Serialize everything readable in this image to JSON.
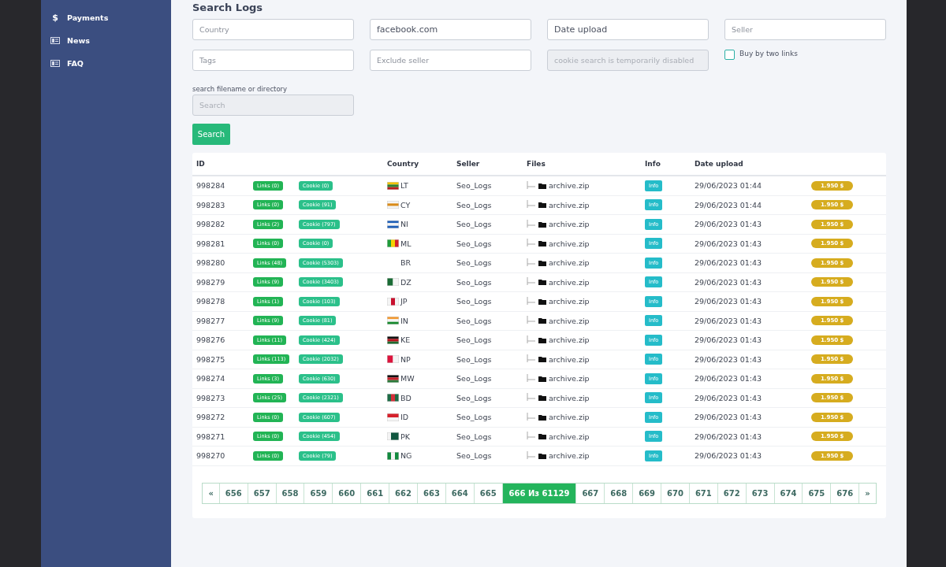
{
  "sidebar": {
    "items": [
      {
        "kind": "glyph",
        "glyph": "$",
        "label": "Payments"
      },
      {
        "kind": "card",
        "label": "News"
      },
      {
        "kind": "card",
        "label": "FAQ"
      }
    ]
  },
  "search_form": {
    "title": "Search Logs",
    "fields": [
      {
        "kind": "input",
        "placeholder": "Country"
      },
      {
        "kind": "input",
        "value": "facebook.com"
      },
      {
        "kind": "input",
        "value": "Date upload"
      },
      {
        "kind": "input",
        "placeholder": "Seller"
      },
      {
        "kind": "input",
        "placeholder": "Tags"
      },
      {
        "kind": "input",
        "placeholder": "Exclude seller"
      },
      {
        "kind": "input",
        "placeholder": "cookie search is temporarily disabled",
        "disabled": true
      },
      {
        "kind": "checkbox",
        "label": "Buy by two links",
        "checked": false
      }
    ],
    "filename_label": "search filename or directory",
    "filename_field": {
      "placeholder": "Search",
      "disabled": true
    },
    "button": "Search"
  },
  "table": {
    "columns": [
      "ID",
      "Country",
      "Seller",
      "Files",
      "Info",
      "Date upload"
    ],
    "rows": [
      {
        "id": "998284",
        "links": "Links (0)",
        "cookie": "Cookie (0)",
        "country": "LT",
        "seller": "Seo_Logs",
        "file": "archive.zip",
        "info": "Info",
        "date": "29/06/2023 01:44",
        "price": "1.950 $"
      },
      {
        "id": "998283",
        "links": "Links (0)",
        "cookie": "Cookie (91)",
        "country": "CY",
        "seller": "Seo_Logs",
        "file": "archive.zip",
        "info": "Info",
        "date": "29/06/2023 01:44",
        "price": "1.950 $"
      },
      {
        "id": "998282",
        "links": "Links (2)",
        "cookie": "Cookie (797)",
        "country": "NI",
        "seller": "Seo_Logs",
        "file": "archive.zip",
        "info": "Info",
        "date": "29/06/2023 01:43",
        "price": "1.950 $"
      },
      {
        "id": "998281",
        "links": "Links (0)",
        "cookie": "Cookie (0)",
        "country": "ML",
        "seller": "Seo_Logs",
        "file": "archive.zip",
        "info": "Info",
        "date": "29/06/2023 01:43",
        "price": "1.950 $"
      },
      {
        "id": "998280",
        "links": "Links (48)",
        "cookie": "Cookie (5303)",
        "country": "BR",
        "seller": "Seo_Logs",
        "file": "archive.zip",
        "info": "Info",
        "date": "29/06/2023 01:43",
        "price": "1.950 $"
      },
      {
        "id": "998279",
        "links": "Links (9)",
        "cookie": "Cookie (3403)",
        "country": "DZ",
        "seller": "Seo_Logs",
        "file": "archive.zip",
        "info": "Info",
        "date": "29/06/2023 01:43",
        "price": "1.950 $"
      },
      {
        "id": "998278",
        "links": "Links (1)",
        "cookie": "Cookie (103)",
        "country": "JP",
        "seller": "Seo_Logs",
        "file": "archive.zip",
        "info": "Info",
        "date": "29/06/2023 01:43",
        "price": "1.950 $"
      },
      {
        "id": "998277",
        "links": "Links (9)",
        "cookie": "Cookie (81)",
        "country": "IN",
        "seller": "Seo_Logs",
        "file": "archive.zip",
        "info": "Info",
        "date": "29/06/2023 01:43",
        "price": "1.950 $"
      },
      {
        "id": "998276",
        "links": "Links (11)",
        "cookie": "Cookie (424)",
        "country": "KE",
        "seller": "Seo_Logs",
        "file": "archive.zip",
        "info": "Info",
        "date": "29/06/2023 01:43",
        "price": "1.950 $"
      },
      {
        "id": "998275",
        "links": "Links (113)",
        "cookie": "Cookie (2032)",
        "country": "NP",
        "seller": "Seo_Logs",
        "file": "archive.zip",
        "info": "Info",
        "date": "29/06/2023 01:43",
        "price": "1.950 $"
      },
      {
        "id": "998274",
        "links": "Links (3)",
        "cookie": "Cookie (630)",
        "country": "MW",
        "seller": "Seo_Logs",
        "file": "archive.zip",
        "info": "Info",
        "date": "29/06/2023 01:43",
        "price": "1.950 $"
      },
      {
        "id": "998273",
        "links": "Links (25)",
        "cookie": "Cookie (2321)",
        "country": "BD",
        "seller": "Seo_Logs",
        "file": "archive.zip",
        "info": "Info",
        "date": "29/06/2023 01:43",
        "price": "1.950 $"
      },
      {
        "id": "998272",
        "links": "Links (0)",
        "cookie": "Cookie (607)",
        "country": "ID",
        "seller": "Seo_Logs",
        "file": "archive.zip",
        "info": "Info",
        "date": "29/06/2023 01:43",
        "price": "1.950 $"
      },
      {
        "id": "998271",
        "links": "Links (0)",
        "cookie": "Cookie (454)",
        "country": "PK",
        "seller": "Seo_Logs",
        "file": "archive.zip",
        "info": "Info",
        "date": "29/06/2023 01:43",
        "price": "1.950 $"
      },
      {
        "id": "998270",
        "links": "Links (0)",
        "cookie": "Cookie (79)",
        "country": "NG",
        "seller": "Seo_Logs",
        "file": "archive.zip",
        "info": "Info",
        "date": "29/06/2023 01:43",
        "price": "1.950 $"
      }
    ]
  },
  "pagination": [
    {
      "label": "«",
      "selected": false
    },
    {
      "label": "656",
      "selected": false
    },
    {
      "label": "657",
      "selected": false
    },
    {
      "label": "658",
      "selected": false
    },
    {
      "label": "659",
      "selected": false
    },
    {
      "label": "660",
      "selected": false
    },
    {
      "label": "661",
      "selected": false
    },
    {
      "label": "662",
      "selected": false
    },
    {
      "label": "663",
      "selected": false
    },
    {
      "label": "664",
      "selected": false
    },
    {
      "label": "665",
      "selected": false
    },
    {
      "label": "666 Из 61129",
      "selected": true
    },
    {
      "label": "667",
      "selected": false
    },
    {
      "label": "668",
      "selected": false
    },
    {
      "label": "669",
      "selected": false
    },
    {
      "label": "670",
      "selected": false
    },
    {
      "label": "671",
      "selected": false
    },
    {
      "label": "672",
      "selected": false
    },
    {
      "label": "673",
      "selected": false
    },
    {
      "label": "674",
      "selected": false
    },
    {
      "label": "675",
      "selected": false
    },
    {
      "label": "676",
      "selected": false
    },
    {
      "label": "»",
      "selected": false
    }
  ]
}
